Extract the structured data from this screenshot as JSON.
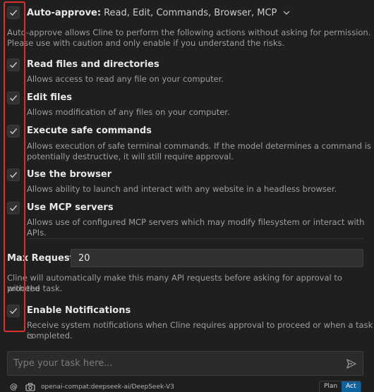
{
  "header": {
    "title": "Auto-approve:",
    "items": "Read, Edit, Commands, Browser, MCP",
    "description_line1": "Auto-approve allows Cline to perform the following actions without asking for permission.",
    "description_line2": "Please use with caution and only enable if you understand the risks."
  },
  "actions": [
    {
      "title": "Read files and directories",
      "description": "Allows access to read any file on your computer.",
      "checked": true
    },
    {
      "title": "Edit files",
      "description": "Allows modification of any files on your computer.",
      "checked": true
    },
    {
      "title": "Execute safe commands",
      "description_line1": "Allows execution of safe terminal commands. If the model determines a command is",
      "description_line2": "potentially destructive, it will still require approval.",
      "checked": true
    },
    {
      "title": "Use the browser",
      "description": "Allows ability to launch and interact with any website in a headless browser.",
      "checked": true
    },
    {
      "title": "Use MCP servers",
      "description": "Allows use of configured MCP servers which may modify filesystem or interact with APIs.",
      "checked": true
    }
  ],
  "max_requests": {
    "label": "Max Requests:",
    "value": "20",
    "help_line1": "Cline will automatically make this many API requests before asking for approval to proceed",
    "help_line2": "with the task."
  },
  "notifications": {
    "title": "Enable Notifications",
    "description_line1": "Receive system notifications when Cline requires approval to proceed or when a task is",
    "description_line2": "completed.",
    "checked": true
  },
  "task_input": {
    "placeholder": "Type your task here..."
  },
  "footer": {
    "at_symbol": "@",
    "model": "openai-compat:deepseek-ai/DeepSeek-V3",
    "mode_plan": "Plan",
    "mode_act": "Act",
    "active_mode": "Act"
  },
  "icons": {
    "checkbox_check": "check-icon",
    "header_chevron": "chevron-down-icon",
    "send": "send-icon",
    "camera": "camera-icon"
  },
  "colors": {
    "background": "#1f1f1f",
    "highlight_border": "#d9302b",
    "accent": "#0e639c"
  }
}
